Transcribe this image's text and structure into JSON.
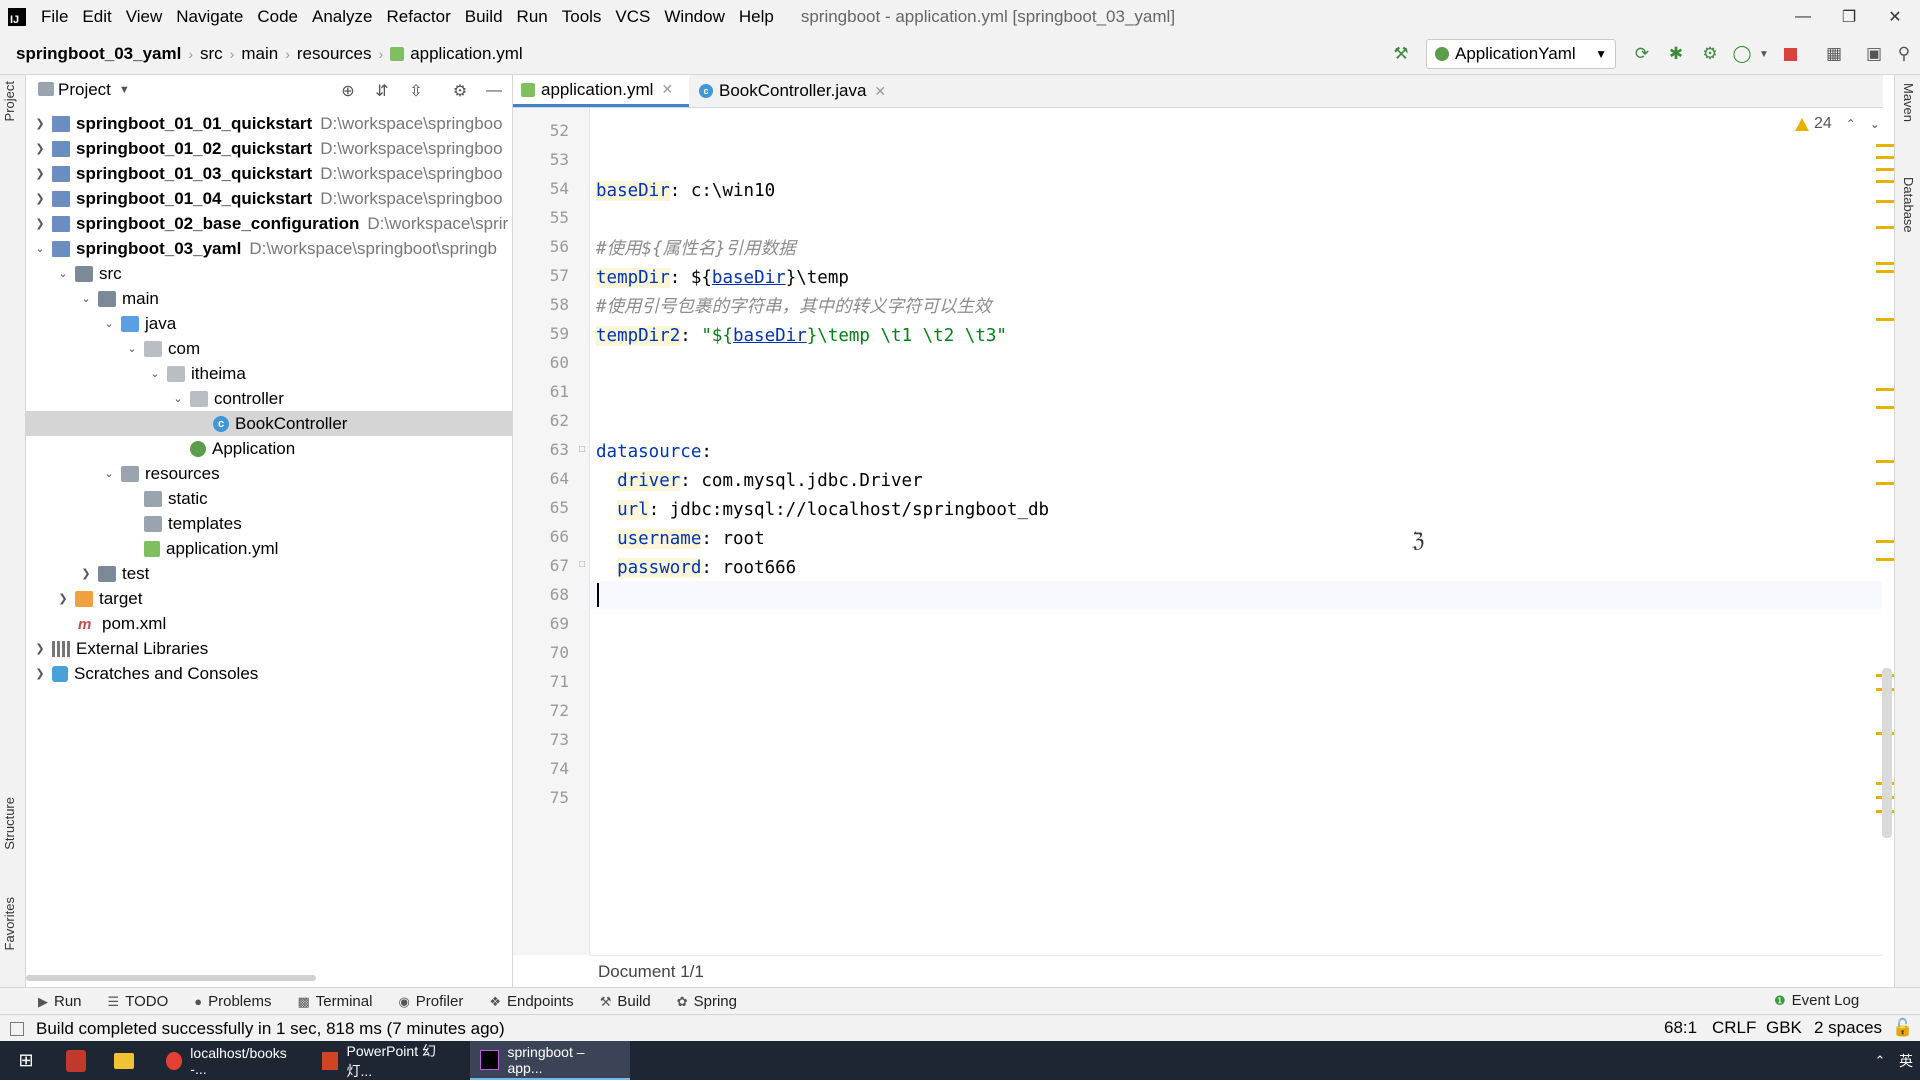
{
  "menubar": {
    "items": [
      "File",
      "Edit",
      "View",
      "Navigate",
      "Code",
      "Analyze",
      "Refactor",
      "Build",
      "Run",
      "Tools",
      "VCS",
      "Window",
      "Help"
    ],
    "window_title": "springboot - application.yml [springboot_03_yaml]"
  },
  "navbar": {
    "crumbs": [
      "springboot_03_yaml",
      "src",
      "main",
      "resources",
      "application.yml"
    ],
    "run_config": "ApplicationYaml"
  },
  "side_tabs": {
    "project": "Project",
    "structure": "Structure",
    "favorites": "Favorites",
    "maven": "Maven",
    "database": "Database"
  },
  "project_panel": {
    "title": "Project",
    "tree": [
      {
        "label": "springboot_01_01_quickstart",
        "path": "D:\\workspace\\springboo",
        "bold": true
      },
      {
        "label": "springboot_01_02_quickstart",
        "path": "D:\\workspace\\springboo",
        "bold": true
      },
      {
        "label": "springboot_01_03_quickstart",
        "path": "D:\\workspace\\springboo",
        "bold": true
      },
      {
        "label": "springboot_01_04_quickstart",
        "path": "D:\\workspace\\springboo",
        "bold": true
      },
      {
        "label": "springboot_02_base_configuration",
        "path": "D:\\workspace\\sprir",
        "bold": true
      },
      {
        "label": "springboot_03_yaml",
        "path": "D:\\workspace\\springboot\\springb",
        "bold": true
      },
      {
        "label": "src"
      },
      {
        "label": "main"
      },
      {
        "label": "java"
      },
      {
        "label": "com"
      },
      {
        "label": "itheima"
      },
      {
        "label": "controller"
      },
      {
        "label": "BookController"
      },
      {
        "label": "Application"
      },
      {
        "label": "resources"
      },
      {
        "label": "static"
      },
      {
        "label": "templates"
      },
      {
        "label": "application.yml"
      },
      {
        "label": "test"
      },
      {
        "label": "target"
      },
      {
        "label": "pom.xml"
      },
      {
        "label": "External Libraries"
      },
      {
        "label": "Scratches and Consoles"
      }
    ]
  },
  "editor": {
    "tabs": [
      "application.yml",
      "BookController.java"
    ],
    "warnings_count": "24",
    "line_numbers": [
      "52",
      "53",
      "54",
      "55",
      "56",
      "57",
      "58",
      "59",
      "60",
      "61",
      "62",
      "63",
      "64",
      "65",
      "66",
      "67",
      "68",
      "69",
      "70",
      "71",
      "72",
      "73",
      "74",
      "75"
    ],
    "code": {
      "basedir_key": "baseDir",
      "basedir_val": " c:\\win10",
      "comment1": "#使用${属性名}引用数据",
      "tempdir_key": "tempDir",
      "tempdir_pre": " ${",
      "tempdir_ref": "baseDir",
      "tempdir_post": "}\\temp",
      "comment2": "#使用引号包裹的字符串，其中的转义字符可以生效",
      "tempdir2_key": "tempDir2",
      "tempdir2_pre": "\"${",
      "tempdir2_ref": "baseDir",
      "tempdir2_post": "}\\temp \\t1 \\t2 \\t3\"",
      "datasource_key": "datasource",
      "driver_key": "driver",
      "driver_val": " com.mysql.jdbc.Driver",
      "url_key": "url",
      "url_val": " jdbc:mysql://localhost/springboot_db",
      "username_key": "username",
      "username_val": " root",
      "password_key": "password",
      "password_val": " root666"
    },
    "doc_crumb": "Document 1/1"
  },
  "toolwindows": [
    "Run",
    "TODO",
    "Problems",
    "Terminal",
    "Profiler",
    "Endpoints",
    "Build",
    "Spring"
  ],
  "event_log": "Event Log",
  "status": {
    "message": "Build completed successfully in 1 sec, 818 ms (7 minutes ago)",
    "position": "68:1",
    "line_sep": "CRLF",
    "encoding": "GBK",
    "indent": "2 spaces"
  },
  "taskbar": {
    "apps": [
      "localhost/books -...",
      "PowerPoint 幻灯...",
      "springboot – app..."
    ],
    "ime": "英"
  },
  "colors": {
    "keyword": "#0033b3",
    "string": "#067d17",
    "comment": "#8c8c8c",
    "warning": "#e6b200",
    "selection": "#d5d5d5"
  }
}
